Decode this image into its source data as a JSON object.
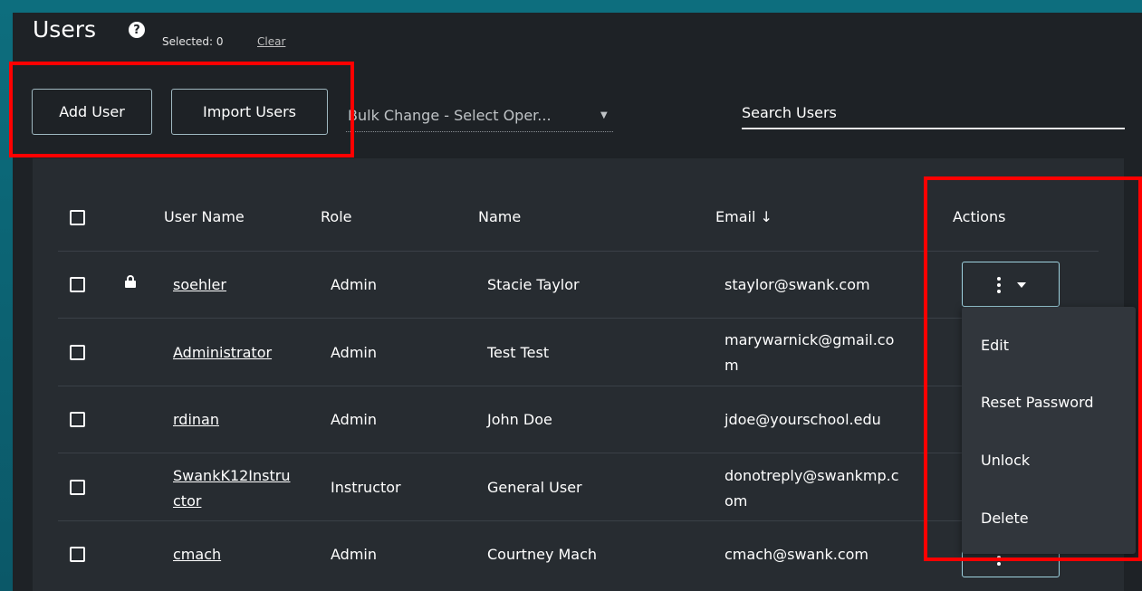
{
  "header": {
    "title": "Users",
    "help_icon": "question-circle-icon",
    "selected_label": "Selected: 0",
    "clear_link": "Clear"
  },
  "toolbar": {
    "add_user": "Add User",
    "import_users": "Import Users",
    "bulk_change": "Bulk Change - Select Oper...",
    "search_placeholder": "Search Users"
  },
  "table": {
    "columns": {
      "username": "User Name",
      "role": "Role",
      "name": "Name",
      "email": "Email ↓",
      "actions": "Actions"
    },
    "rows": [
      {
        "username": "soehler",
        "role": "Admin",
        "name": "Stacie Taylor",
        "email": "staylor@swank.com",
        "locked": true
      },
      {
        "username": "Administrator",
        "role": "Admin",
        "name": "Test Test",
        "email_line1": "marywarnick@gmail.co",
        "email_line2": "m",
        "locked": false
      },
      {
        "username": "rdinan",
        "role": "Admin",
        "name": "John Doe",
        "email": "jdoe@yourschool.edu",
        "locked": false
      },
      {
        "username_line1": "SwankK12Instru",
        "username_line2": "ctor",
        "role": "Instructor",
        "name": "General User",
        "email_line1": "donotreply@swankmp.c",
        "email_line2": "om",
        "locked": false
      },
      {
        "username": "cmach",
        "role": "Admin",
        "name": "Courtney Mach",
        "email": "cmach@swank.com",
        "locked": false
      }
    ]
  },
  "actions_menu": {
    "items": [
      "Edit",
      "Reset Password",
      "Unlock",
      "Delete"
    ]
  },
  "colors": {
    "panel": "#1e2226",
    "table_bg": "#272c31",
    "menu_bg": "#31363c",
    "highlight": "#ff0000"
  }
}
